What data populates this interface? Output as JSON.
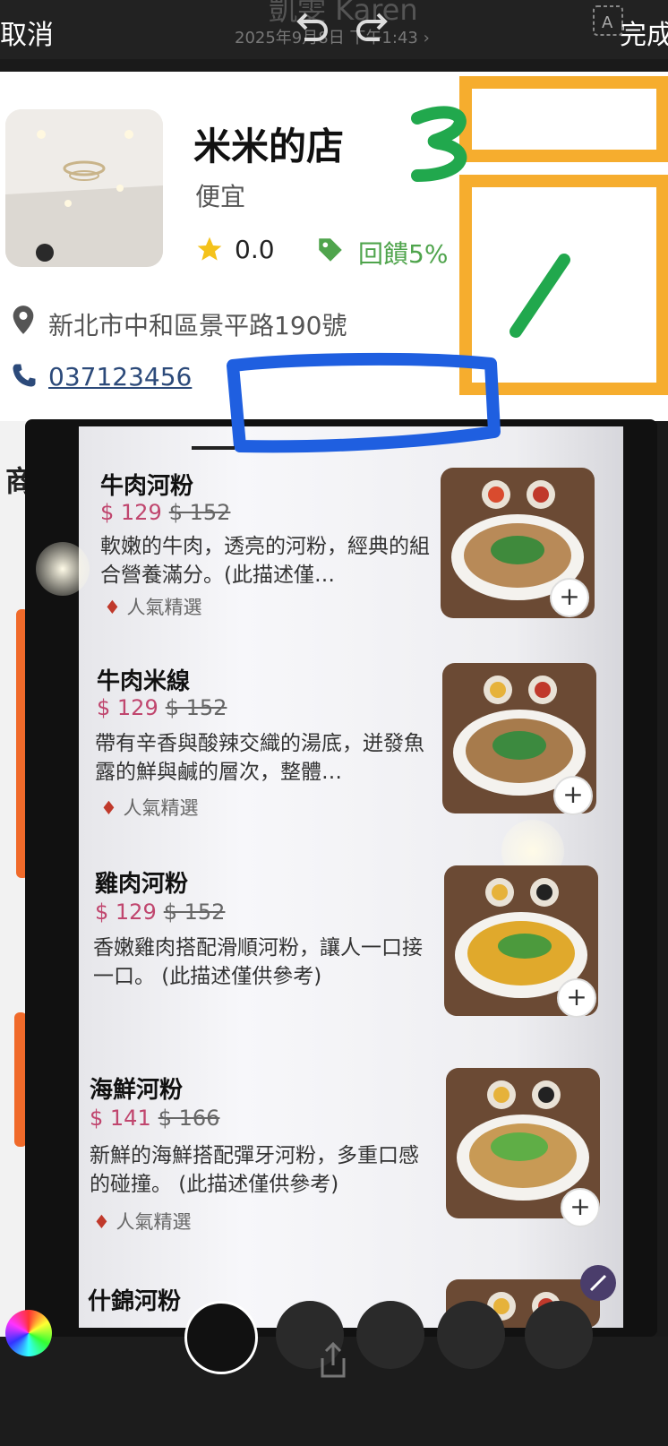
{
  "topbar": {
    "cancel_label": "取消",
    "done_label": "完成",
    "ghost_title": "凱雯 Karen",
    "ghost_date": "2025年9月8日 下午1:43 ›",
    "icons": [
      "undo-icon",
      "redo-icon",
      "text-style-icon"
    ]
  },
  "store": {
    "name": "米米的店",
    "tag": "便宜",
    "rating": "0.0",
    "rebate": "回饋5%",
    "address": "新北市中和區景平路190號",
    "phone": "037123456"
  },
  "left_layer": {
    "section_char": "商"
  },
  "annotations": {
    "number_3": "3",
    "number_1": "/"
  },
  "menu": {
    "items": [
      {
        "name": "牛肉河粉",
        "price": "$ 129",
        "old_price": "$ 152",
        "desc": "軟嫩的牛肉，透亮的河粉，經典的組合營養滿分。(此描述僅…",
        "badge": "人氣精選",
        "plus": "+"
      },
      {
        "name": "牛肉米線",
        "price": "$ 129",
        "old_price": "$ 152",
        "desc": "帶有辛香與酸辣交織的湯底，迸發魚露的鮮與鹹的層次，整體…",
        "badge": "人氣精選",
        "plus": "+"
      },
      {
        "name": "雞肉河粉",
        "price": "$ 129",
        "old_price": "$ 152",
        "desc": "香嫩雞肉搭配滑順河粉，讓人一口接一口。 (此描述僅供參考)",
        "badge": "",
        "plus": "+"
      },
      {
        "name": "海鮮河粉",
        "price": "$ 141",
        "old_price": "$ 166",
        "desc": "新鮮的海鮮搭配彈牙河粉，多重口感的碰撞。 (此描述僅供參考)",
        "badge": "人氣精選",
        "plus": "+"
      },
      {
        "name": "什錦河粉",
        "price": "",
        "old_price": "",
        "desc": "",
        "badge": "",
        "plus": ""
      }
    ]
  },
  "colors": {
    "price": "#c0466e",
    "rebate": "#4fa44c",
    "star": "#f4c21b",
    "marker_blue": "#1f5fe0",
    "marker_orange": "#f6ad2e",
    "marker_green": "#21a84d"
  }
}
